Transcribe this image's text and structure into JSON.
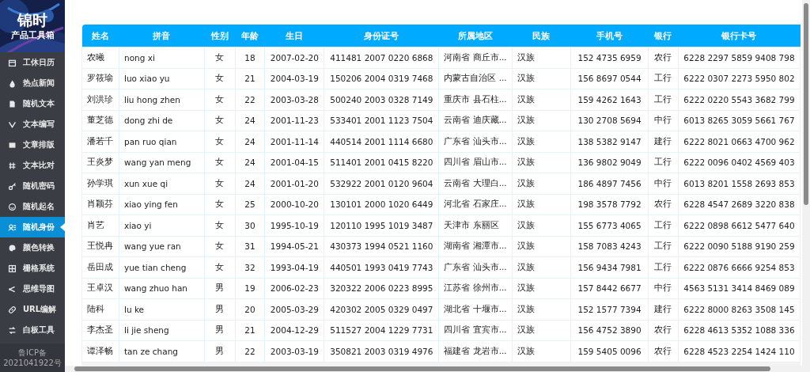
{
  "sidebar": {
    "logo_title": "锦时",
    "logo_subtitle": "产品工具箱",
    "items": [
      {
        "label": "工休日历",
        "selected": false
      },
      {
        "label": "热点新闻",
        "selected": false
      },
      {
        "label": "随机文本",
        "selected": false
      },
      {
        "label": "文本编写",
        "selected": false
      },
      {
        "label": "文章排版",
        "selected": false
      },
      {
        "label": "文本比对",
        "selected": false
      },
      {
        "label": "随机密码",
        "selected": false
      },
      {
        "label": "随机起名",
        "selected": false
      },
      {
        "label": "随机身份",
        "selected": true
      },
      {
        "label": "颜色转换",
        "selected": false
      },
      {
        "label": "栅格系统",
        "selected": false
      },
      {
        "label": "思维导图",
        "selected": false
      },
      {
        "label": "URL编解",
        "selected": false
      },
      {
        "label": "白板工具",
        "selected": false
      }
    ],
    "footer": [
      "鲁ICP备",
      "2021041922号"
    ]
  },
  "table": {
    "columns": [
      "姓名",
      "拼音",
      "性别",
      "年龄",
      "生日",
      "身份证号",
      "所属地区",
      "民族",
      "手机号",
      "银行",
      "银行卡号"
    ],
    "rows": [
      [
        "农曦",
        "nong xi",
        "女",
        "18",
        "2007-02-20",
        "411481 2007 0220 6868",
        "河南省 商丘市...",
        "汉族",
        "152 4735 6959",
        "农行",
        "6228 2297 5859 9408 798"
      ],
      [
        "罗筱瑜",
        "luo xiao yu",
        "女",
        "21",
        "2004-03-19",
        "150206 2004 0319 7468",
        "内蒙古自治区 ...",
        "汉族",
        "156 8697 0544",
        "工行",
        "6222 0307 2273 5950 802"
      ],
      [
        "刘洪珍",
        "liu hong zhen",
        "女",
        "22",
        "2003-03-28",
        "500240 2003 0328 7149",
        "重庆市 县石柱...",
        "汉族",
        "159 4262 1643",
        "工行",
        "6222 0220 5543 3682 799"
      ],
      [
        "董芝德",
        "dong zhi de",
        "女",
        "24",
        "2001-11-23",
        "533401 2001 1123 7504",
        "云南省 迪庆藏...",
        "汉族",
        "130 2708 5694",
        "中行",
        "6013 8265 3059 5661 767"
      ],
      [
        "潘若千",
        "pan ruo qian",
        "女",
        "24",
        "2001-11-14",
        "440514 2001 1114 6680",
        "广东省 汕头市...",
        "汉族",
        "138 5382 9147",
        "建行",
        "6222 8021 0663 4700 962"
      ],
      [
        "王炎梦",
        "wang yan meng",
        "女",
        "24",
        "2001-04-15",
        "511401 2001 0415 8220",
        "四川省 眉山市...",
        "汉族",
        "136 9802 9049",
        "工行",
        "6222 0096 0402 4569 403"
      ],
      [
        "孙学琪",
        "xun xue qi",
        "女",
        "24",
        "2001-01-20",
        "532922 2001 0120 9604",
        "云南省 大理白...",
        "汉族",
        "186 4897 7456",
        "中行",
        "6013 8201 1558 2693 853"
      ],
      [
        "肖颖芬",
        "xiao ying fen",
        "女",
        "25",
        "2000-10-20",
        "130101 2000 1020 6449",
        "河北省 石家庄...",
        "汉族",
        "198 3578 7792",
        "农行",
        "6228 4547 2689 3220 838"
      ],
      [
        "肖艺",
        "xiao yi",
        "女",
        "30",
        "1995-10-19",
        "120110 1995 1019 3487",
        "天津市 东丽区",
        "汉族",
        "155 6773 4065",
        "工行",
        "6222 0898 6612 5477 640"
      ],
      [
        "王悦冉",
        "wang yue ran",
        "女",
        "31",
        "1994-05-21",
        "430373 1994 0521 1160",
        "湖南省 湘潭市...",
        "汉族",
        "158 7083 4243",
        "工行",
        "6222 0090 5188 9190 259"
      ],
      [
        "岳田成",
        "yue tian cheng",
        "女",
        "32",
        "1993-04-19",
        "440501 1993 0419 7743",
        "广东省 汕头市...",
        "汉族",
        "156 9434 7981",
        "工行",
        "6222 0876 6666 9254 853"
      ],
      [
        "王卓汉",
        "wang zhuo han",
        "男",
        "19",
        "2006-02-23",
        "320322 2006 0223 8995",
        "江苏省 徐州市...",
        "汉族",
        "157 8442 6677",
        "中行",
        "4563 5131 3414 8469 089"
      ],
      [
        "陆科",
        "lu ke",
        "男",
        "20",
        "2005-03-29",
        "420302 2005 0329 0497",
        "湖北省 十堰市...",
        "汉族",
        "152 1577 7394",
        "建行",
        "6222 8000 8263 3508 145"
      ],
      [
        "李杰圣",
        "li jie sheng",
        "男",
        "21",
        "2004-12-29",
        "511527 2004 1229 7731",
        "四川省 宜宾市...",
        "汉族",
        "156 4752 3890",
        "农行",
        "6228 4613 5352 1088 336"
      ],
      [
        "谭泽畅",
        "tan ze chang",
        "男",
        "22",
        "2003-03-19",
        "350821 2003 0319 4976",
        "福建省 龙岩市...",
        "汉族",
        "159 5405 0096",
        "农行",
        "6228 4523 2254 1424 110"
      ]
    ]
  }
}
